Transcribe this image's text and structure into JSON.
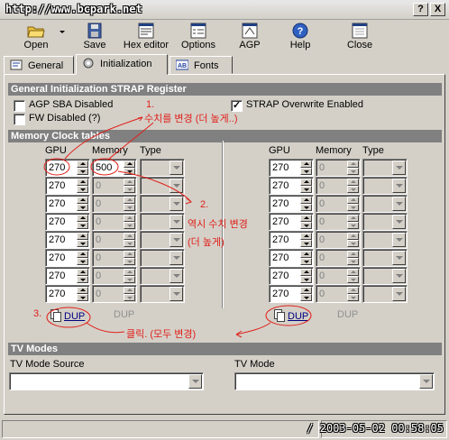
{
  "window": {
    "title": "http://www.bcpark.net",
    "help_btn": "?",
    "close_btn": "X"
  },
  "toolbar": {
    "open": "Open",
    "save": "Save",
    "hex_editor": "Hex editor",
    "options": "Options",
    "agp": "AGP",
    "help": "Help",
    "close": "Close"
  },
  "tabs": {
    "general": "General",
    "initialization": "Initialization",
    "fonts": "Fonts"
  },
  "strap": {
    "header": "General Initialization STRAP Register",
    "agp_sba": {
      "label": "AGP SBA Disabled",
      "checked": false
    },
    "fw": {
      "label": "FW Disabled (?)",
      "checked": false
    },
    "overwrite": {
      "label": "STRAP Overwrite Enabled",
      "checked": true,
      "mark": "✓"
    }
  },
  "memory": {
    "header": "Memory Clock tables",
    "col_gpu": "GPU",
    "col_memory": "Memory",
    "col_type": "Type",
    "left_gpu": [
      "270",
      "270",
      "270",
      "270",
      "270",
      "270",
      "270",
      "270"
    ],
    "left_mem": [
      "500",
      "0",
      "0",
      "0",
      "0",
      "0",
      "0",
      "0"
    ],
    "right_gpu": [
      "270",
      "270",
      "270",
      "270",
      "270",
      "270",
      "270",
      "270"
    ],
    "right_mem": [
      "0",
      "0",
      "0",
      "0",
      "0",
      "0",
      "0",
      "0"
    ],
    "dup_label": "DUP"
  },
  "tv": {
    "header": "TV Modes",
    "source_label": "TV Mode Source",
    "mode_label": "TV Mode"
  },
  "status": {
    "timestamp": "/ 2003-05-02 00:58:05"
  },
  "annotations": {
    "n1": "1.",
    "t1": "수치를 변경 (더 높게..)",
    "n2": "2.",
    "t2a": "역시 수치 변경",
    "t2b": "(더 높게)",
    "n3": "3.",
    "t3": "클릭. (모두 변경)",
    "color": "#e0201a"
  }
}
